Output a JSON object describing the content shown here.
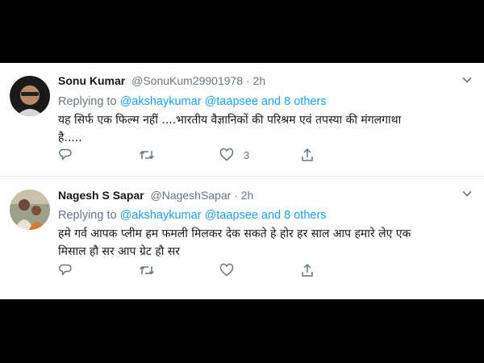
{
  "tweets": [
    {
      "name": "Sonu Kumar",
      "handle": "@SonuKum29901978",
      "time": "· 2h",
      "replying_prefix": "Replying to",
      "mention_1": "@akshaykumar",
      "mention_2": "@taapsee",
      "mention_3": "and 8 others",
      "text": "यह सिर्फ एक फिल्म नहीं ....भारतीय वैज्ञानिकों की परिश्रम एवं तपस्या की मंगलगाथा है.....",
      "likes": "3",
      "icons": [
        "reply-icon",
        "retweet-icon",
        "like-icon",
        "share-icon",
        "chevron-down-icon"
      ]
    },
    {
      "name": "Nagesh S Sapar",
      "handle": "@NageshSapar",
      "time": "· 2h",
      "replying_prefix": "Replying to",
      "mention_1": "@akshaykumar",
      "mention_2": "@taapsee",
      "mention_3": "and 8 others",
      "text": "हमे गर्व आपक प्लीम  हम फमली मिलकर देक सकते हे  होर हर साल आप हमारे लेए एक मिसाल हौ सर  आप ग्रेट हौ सर",
      "likes": "",
      "icons": [
        "reply-icon",
        "retweet-icon",
        "like-icon",
        "share-icon",
        "chevron-down-icon"
      ]
    }
  ],
  "colors": {
    "link": "#1da1f2",
    "muted": "#657786",
    "text": "#14171a"
  }
}
